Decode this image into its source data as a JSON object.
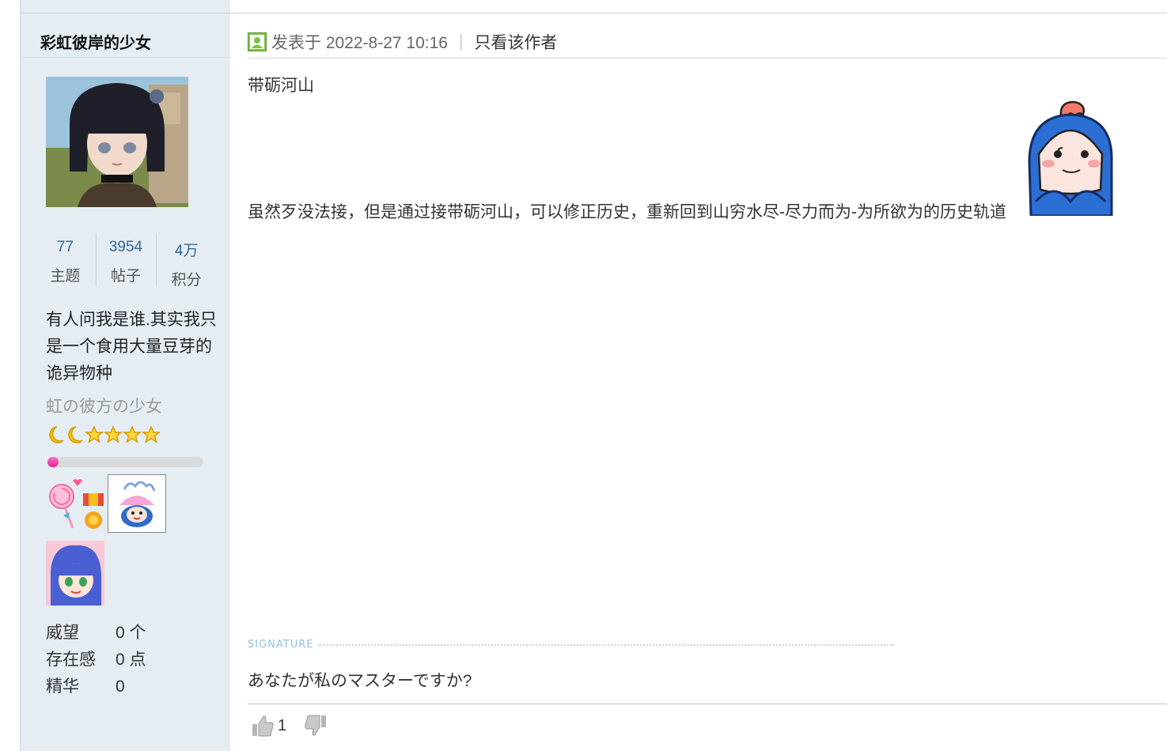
{
  "author": {
    "name": "彩虹彼岸的少女",
    "stats": [
      {
        "value": "77",
        "label": "主题"
      },
      {
        "value": "3954",
        "label": "帖子"
      },
      {
        "value": "4万",
        "label": "积分"
      }
    ],
    "bio": "有人问我是谁.其实我只是一个食用大量豆芽的诡异物种",
    "usergroup": "虹の彼方の少女",
    "level_progress": 0.07,
    "extcredits": [
      {
        "label": "威望",
        "value": "0 个"
      },
      {
        "label": "存在感",
        "value": "0 点"
      },
      {
        "label": "精华",
        "value": "0"
      }
    ]
  },
  "post": {
    "posted_label": "发表于 2022-8-27 10:16",
    "separator": "|",
    "only_author_label": "只看该作者",
    "title": "带砺河山",
    "body": "虽然歹没法接，但是通过接带砺河山，可以修正历史，重新回到山穷水尽-尽力而为-为所欲为的历史轨道",
    "signature_label": "SIGNATURE",
    "signature": "あなたが私のマスターですか?",
    "likes": "1"
  },
  "colors": {
    "sidebar_bg": "#e5edf2",
    "stat_value": "#336699",
    "progress_fill": "#e0249a"
  }
}
